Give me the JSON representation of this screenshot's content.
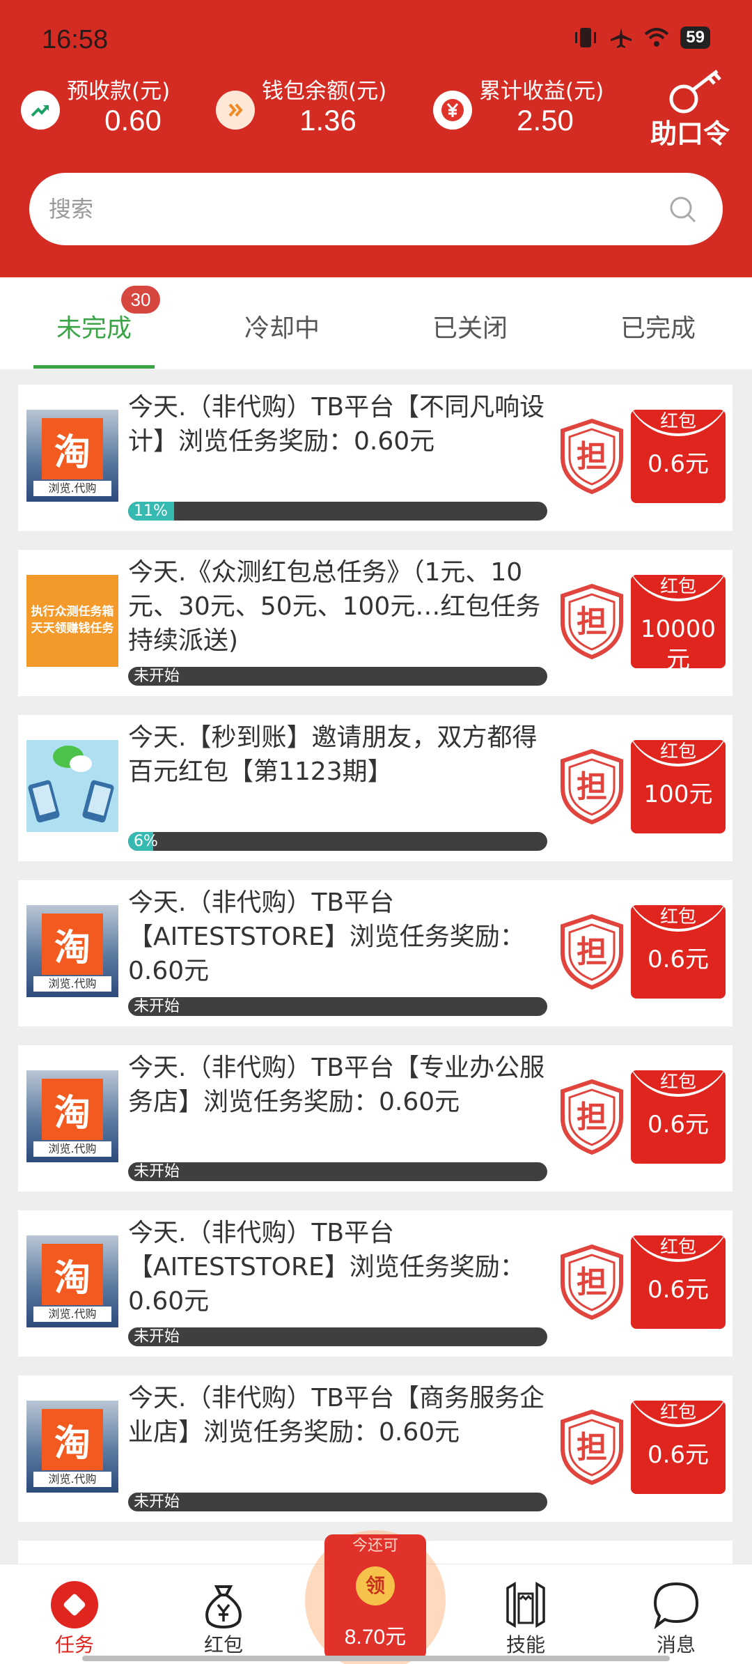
{
  "status_bar": {
    "time": "16:58",
    "battery": "59"
  },
  "stats": [
    {
      "label": "预收款(元)",
      "value": "0.60",
      "icon": "trend-up-icon"
    },
    {
      "label": "钱包余额(元)",
      "value": "1.36",
      "icon": "double-chevron-icon"
    },
    {
      "label": "累计收益(元)",
      "value": "2.50",
      "icon": "yen-icon"
    }
  ],
  "zhukouling": {
    "label": "助口令",
    "icon": "key-icon"
  },
  "search": {
    "placeholder": "搜索"
  },
  "tabs": [
    {
      "label": "未完成",
      "badge": "30"
    },
    {
      "label": "冷却中"
    },
    {
      "label": "已关闭"
    },
    {
      "label": "已完成"
    }
  ],
  "thumb_text": {
    "taobao_char": "淘",
    "taobao_caption": "浏览.代购",
    "promo_line1": "执行众测任务箱",
    "promo_line2": "天天领赚钱任务"
  },
  "tasks": [
    {
      "title": "今天.（非代购）TB平台【不同凡响设计】浏览任务奖励：0.60元",
      "progress_text": "11%",
      "progress": 0.11,
      "hongbao_label": "红包",
      "amount": "0.6元",
      "thumb": "taobao"
    },
    {
      "title": "今天.《众测红包总任务》（1元、10元、30元、50元、100元…红包任务持续派送)",
      "progress_text": "未开始",
      "progress": 0,
      "hongbao_label": "红包",
      "amount": "10000元",
      "thumb": "promo"
    },
    {
      "title": "今天.【秒到账】邀请朋友，双方都得百元红包【第1123期】",
      "progress_text": "6%",
      "progress": 0.06,
      "hongbao_label": "红包",
      "amount": "100元",
      "thumb": "invite"
    },
    {
      "title": "今天.（非代购）TB平台【AITESTSTORE】浏览任务奖励：0.60元",
      "progress_text": "未开始",
      "progress": 0,
      "hongbao_label": "红包",
      "amount": "0.6元",
      "thumb": "taobao"
    },
    {
      "title": "今天.（非代购）TB平台【专业办公服务店】浏览任务奖励：0.60元",
      "progress_text": "未开始",
      "progress": 0,
      "hongbao_label": "红包",
      "amount": "0.6元",
      "thumb": "taobao"
    },
    {
      "title": "今天.（非代购）TB平台【AITESTSTORE】浏览任务奖励：0.60元",
      "progress_text": "未开始",
      "progress": 0,
      "hongbao_label": "红包",
      "amount": "0.6元",
      "thumb": "taobao"
    },
    {
      "title": "今天.（非代购）TB平台【商务服务企业店】浏览任务奖励：0.60元",
      "progress_text": "未开始",
      "progress": 0,
      "hongbao_label": "红包",
      "amount": "0.6元",
      "thumb": "taobao"
    }
  ],
  "dan_char": "担",
  "bottom_nav": [
    {
      "label": "任务",
      "icon": "task-icon",
      "active": true
    },
    {
      "label": "红包",
      "icon": "money-bag-icon"
    },
    {
      "label": "技能",
      "icon": "skill-icon"
    },
    {
      "label": "消息",
      "icon": "message-icon"
    }
  ],
  "claim": {
    "top_text": "今还可",
    "coin_char": "领",
    "amount": "8.70元"
  },
  "colors": {
    "brand_red": "#d42b23",
    "active_green": "#3aa447",
    "progress_teal": "#35b9b0"
  }
}
